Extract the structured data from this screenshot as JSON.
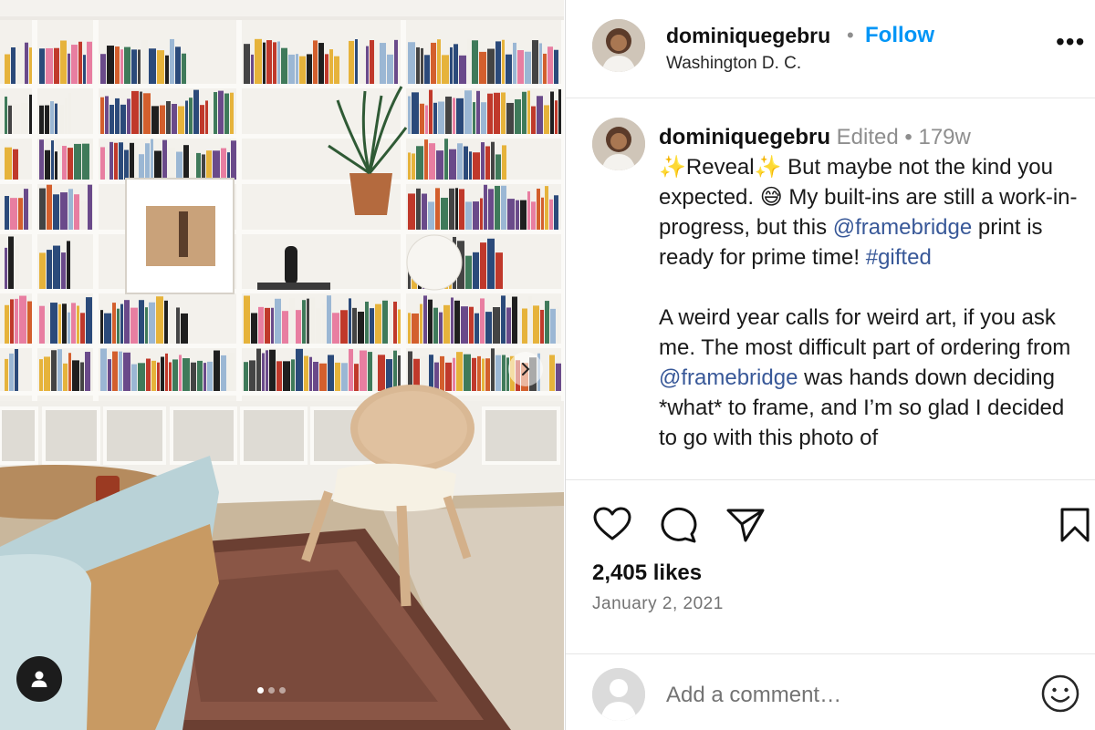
{
  "post": {
    "username": "dominiquegebru",
    "follow_label": "Follow",
    "separator": "•",
    "location": "Washington D. C.",
    "more_label": "•••",
    "image_count": 3,
    "active_image": 1
  },
  "caption": {
    "username": "dominiquegebru",
    "edited_label": "Edited",
    "separator": "•",
    "age": "179w",
    "p1_part1": "✨Reveal✨ But maybe not the kind you expected. 😅 My built-ins are still a work-in-progress, but this ",
    "mention1": "@framebridge",
    "p1_part2": " print is ready for prime time! ",
    "hashtag": "#gifted",
    "p2_part1": "A weird year calls for weird art, if you ask me. The most difficult part of ordering from ",
    "mention2": "@framebridge",
    "p2_part2": " was hands down deciding *what* to frame, and I’m so glad I decided to go with this photo of"
  },
  "stats": {
    "likes": "2,405 likes",
    "date": "January 2, 2021"
  },
  "comment": {
    "placeholder": "Add a comment…"
  },
  "icons": {
    "like": "heart-icon",
    "comment": "comment-icon",
    "share": "share-icon",
    "save": "bookmark-icon",
    "emoji": "emoji-icon",
    "next": "chevron-right-icon",
    "tag": "user-tag-icon"
  },
  "colors": {
    "follow": "#0095f6",
    "mention": "#385898",
    "muted": "#737373"
  }
}
